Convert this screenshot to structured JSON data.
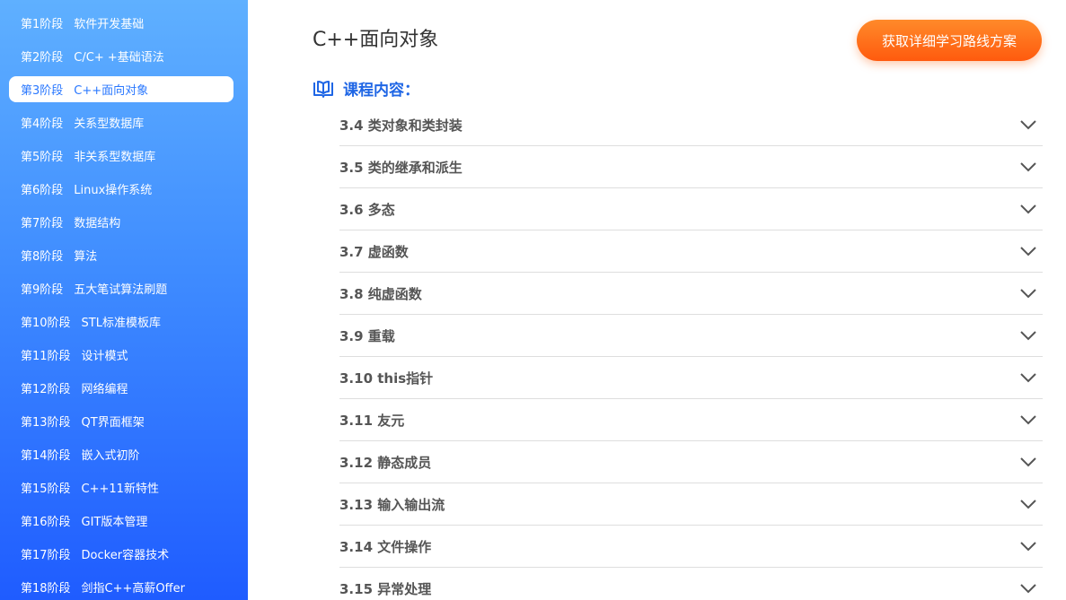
{
  "sidebar": {
    "items": [
      {
        "num": "第1阶段",
        "label": "软件开发基础"
      },
      {
        "num": "第2阶段",
        "label": "C/C+ +基础语法"
      },
      {
        "num": "第3阶段",
        "label": "C++面向对象"
      },
      {
        "num": "第4阶段",
        "label": "关系型数据库"
      },
      {
        "num": "第5阶段",
        "label": "非关系型数据库"
      },
      {
        "num": "第6阶段",
        "label": "Linux操作系统"
      },
      {
        "num": "第7阶段",
        "label": "数据结构"
      },
      {
        "num": "第8阶段",
        "label": "算法"
      },
      {
        "num": "第9阶段",
        "label": "五大笔试算法刷题"
      },
      {
        "num": "第10阶段",
        "label": "STL标准模板库"
      },
      {
        "num": "第11阶段",
        "label": "设计模式"
      },
      {
        "num": "第12阶段",
        "label": "网络编程"
      },
      {
        "num": "第13阶段",
        "label": "QT界面框架"
      },
      {
        "num": "第14阶段",
        "label": "嵌入式初阶"
      },
      {
        "num": "第15阶段",
        "label": "C++11新特性"
      },
      {
        "num": "第16阶段",
        "label": "GIT版本管理"
      },
      {
        "num": "第17阶段",
        "label": "Docker容器技术"
      },
      {
        "num": "第18阶段",
        "label": "剑指C++高薪Offer"
      }
    ],
    "active_index": 2
  },
  "main": {
    "title": "C++面向对象",
    "cta_label": "获取详细学习路线方案",
    "section_title": "课程内容：",
    "topics": [
      "3.4 类对象和类封装",
      "3.5 类的继承和派生",
      "3.6 多态",
      "3.7 虚函数",
      "3.8 纯虚函数",
      "3.9 重载",
      "3.10 this指针",
      "3.11 友元",
      "3.12 静态成员",
      "3.13 输入输出流",
      "3.14 文件操作",
      "3.15 异常处理"
    ]
  },
  "colors": {
    "accent_blue": "#1f66e5",
    "cta_orange": "#ff6a1a",
    "sidebar_top": "#5fb0ff",
    "sidebar_bottom": "#1f5cff"
  },
  "icons": {
    "section": "book-icon",
    "row": "chevron-down-icon"
  }
}
